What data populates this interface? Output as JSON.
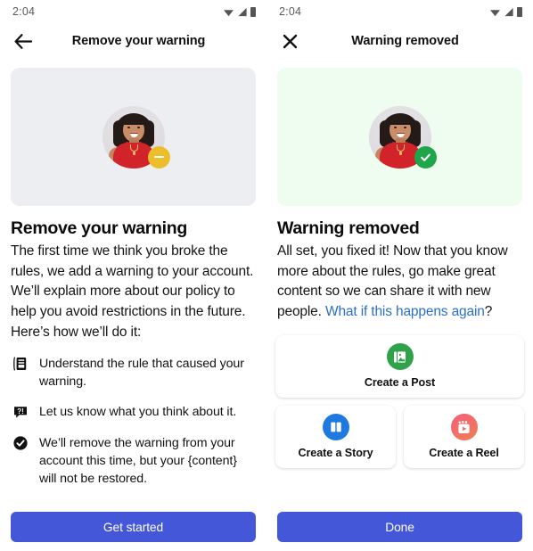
{
  "screens": {
    "left": {
      "status": {
        "time": "2:04",
        "wifi_icon": "wifi-icon",
        "signal_icon": "signal-icon",
        "battery_icon": "battery-icon"
      },
      "appbar": {
        "nav_icon": "back-arrow-icon",
        "title": "Remove your warning"
      },
      "hero": {
        "bg_color": "#eceef2",
        "avatar_icon": "user-avatar",
        "badge_icon": "minus-badge-icon",
        "badge_color": "#edbe2b"
      },
      "title": "Remove your warning",
      "blurb": "The first time we think you broke the rules, we add a warning to your account. We’ll explain more about our policy to help you avoid restrictions in the future. Here’s how we’ll do it:",
      "list": [
        {
          "icon": "rulebook-icon",
          "text": "Understand the rule that caused your warning."
        },
        {
          "icon": "question-bubble-icon",
          "text": "Let us know what you think about it."
        },
        {
          "icon": "check-circle-icon",
          "text": "We’ll remove the warning from your account this time, but your {content} will not be restored."
        }
      ],
      "cta": {
        "label": "Get started",
        "color": "#4457d9"
      }
    },
    "right": {
      "status": {
        "time": "2:04",
        "wifi_icon": "wifi-icon",
        "signal_icon": "signal-icon",
        "battery_icon": "battery-icon"
      },
      "appbar": {
        "nav_icon": "close-x-icon",
        "title": "Warning removed"
      },
      "hero": {
        "bg_color": "#eefdf0",
        "avatar_icon": "user-avatar",
        "badge_icon": "check-badge-icon",
        "badge_color": "#20a64a"
      },
      "title": "Warning removed",
      "blurb_text": "All set, you fixed it! Now that you know more about the rules, go make great content so we can share it with new people. ",
      "blurb_link": "What if this happens again",
      "blurb_tail": "?",
      "link_color": "#2b6ecb",
      "cards": [
        {
          "label": "Create a Post",
          "icon": "photo-post-icon",
          "icon_color": "#31a24c"
        },
        {
          "label": "Create a Story",
          "icon": "book-story-icon",
          "icon_color": "#1f7ae0"
        },
        {
          "label": "Create a Reel",
          "icon": "video-reel-icon",
          "icon_color": "#f06a66"
        }
      ],
      "cta": {
        "label": "Done",
        "color": "#4457d9"
      }
    }
  }
}
